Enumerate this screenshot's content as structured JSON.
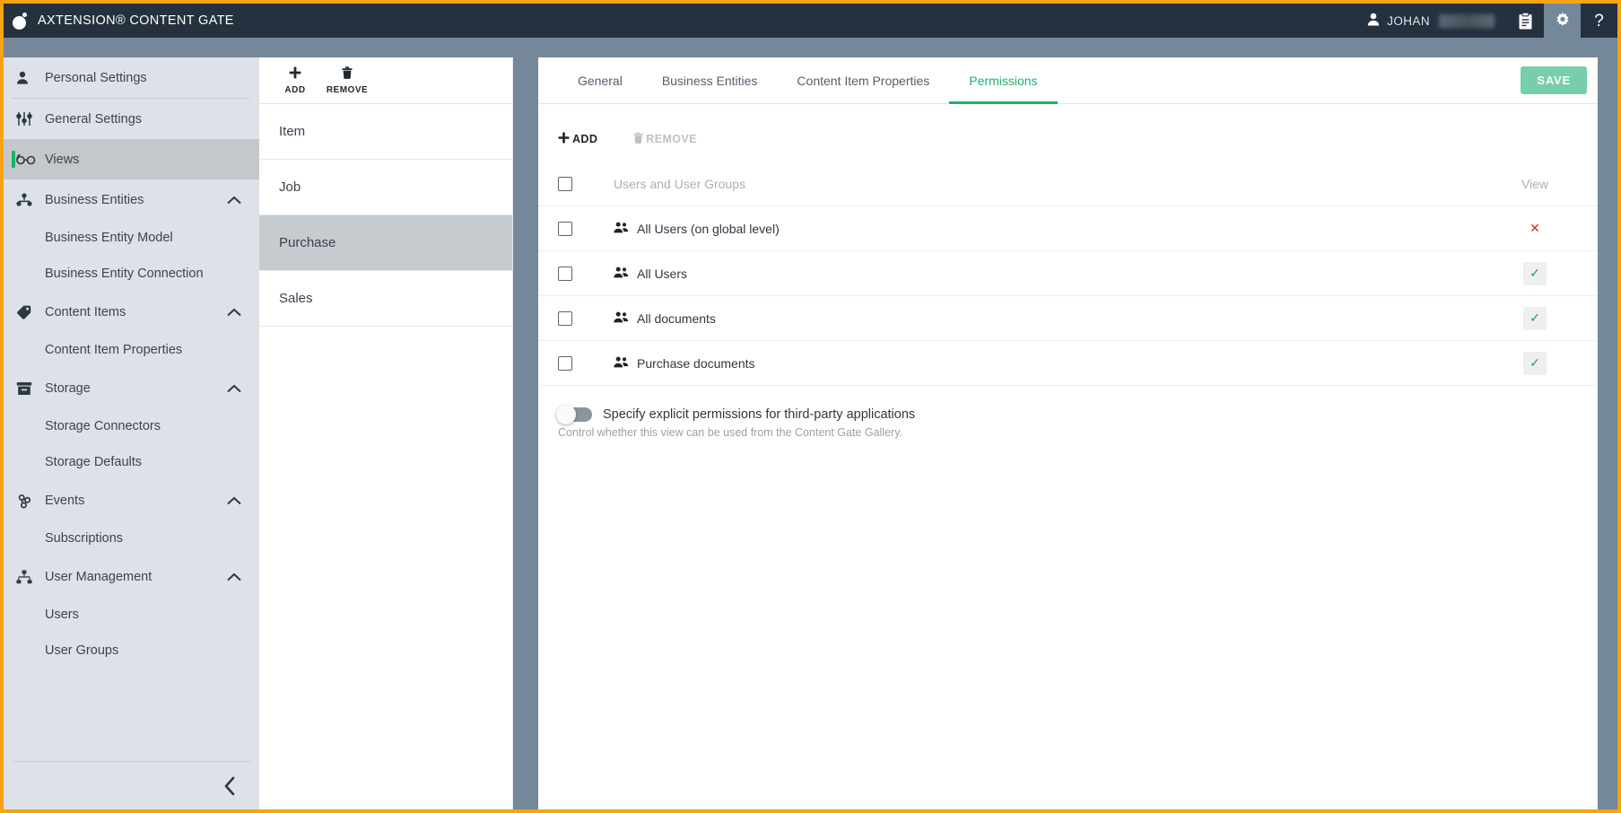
{
  "header": {
    "logo_icon": "axtension-logo-icon",
    "title": "AXTENSION® CONTENT GATE",
    "user_icon": "user-icon",
    "user_name": "JOHAN",
    "clipboard_icon": "clipboard-icon",
    "gear_icon": "gear-icon",
    "help_icon": "help-question-icon",
    "help_glyph": "?",
    "brand_color": "#f5a312",
    "bar_color": "#25313f"
  },
  "sidebar": {
    "collapse_icon": "chevron-left-icon",
    "items": [
      {
        "label": "Personal Settings",
        "icon": "person-icon",
        "type": "item",
        "selected": false,
        "expandable": false
      },
      {
        "label": "General Settings",
        "icon": "sliders-icon",
        "type": "item",
        "selected": false,
        "expandable": false
      },
      {
        "label": "Views",
        "icon": "glasses-icon",
        "type": "item",
        "selected": true,
        "expandable": false
      },
      {
        "label": "Business Entities",
        "icon": "hierarchy-icon",
        "type": "group",
        "selected": false,
        "expandable": true
      },
      {
        "label": "Business Entity Model",
        "type": "sub"
      },
      {
        "label": "Business Entity Connection",
        "type": "sub"
      },
      {
        "label": "Content Items",
        "icon": "tag-icon",
        "type": "group",
        "selected": false,
        "expandable": true
      },
      {
        "label": "Content Item Properties",
        "type": "sub"
      },
      {
        "label": "Storage",
        "icon": "archive-box-icon",
        "type": "group",
        "selected": false,
        "expandable": true
      },
      {
        "label": "Storage Connectors",
        "type": "sub"
      },
      {
        "label": "Storage Defaults",
        "type": "sub"
      },
      {
        "label": "Events",
        "icon": "webhook-icon",
        "type": "group",
        "selected": false,
        "expandable": true
      },
      {
        "label": "Subscriptions",
        "type": "sub"
      },
      {
        "label": "User Management",
        "icon": "sitemap-icon",
        "type": "group",
        "selected": false,
        "expandable": true
      },
      {
        "label": "Users",
        "type": "sub"
      },
      {
        "label": "User Groups",
        "type": "sub"
      }
    ]
  },
  "list_panel": {
    "toolbar": {
      "add_label": "ADD",
      "add_icon": "plus-icon",
      "remove_label": "REMOVE",
      "remove_icon": "trash-icon"
    },
    "rows": [
      {
        "label": "Item",
        "selected": false
      },
      {
        "label": "Job",
        "selected": false
      },
      {
        "label": "Purchase",
        "selected": true
      },
      {
        "label": "Sales",
        "selected": false
      }
    ]
  },
  "main": {
    "tabs": [
      {
        "label": "General",
        "active": false
      },
      {
        "label": "Business Entities",
        "active": false
      },
      {
        "label": "Content Item Properties",
        "active": false
      },
      {
        "label": "Permissions",
        "active": true
      }
    ],
    "save_label": "SAVE",
    "accent_color": "#19b26b",
    "permissions": {
      "toolbar": {
        "add_label": "ADD",
        "add_icon": "plus-icon",
        "remove_label": "REMOVE",
        "remove_icon": "trash-icon",
        "remove_disabled": true
      },
      "columns": {
        "name": "Users and User Groups",
        "view": "View"
      },
      "rows": [
        {
          "name": "All Users (on global level)",
          "icon": "users-group-icon",
          "checked": false,
          "view": "deny",
          "view_glyph": "✕"
        },
        {
          "name": "All Users",
          "icon": "users-group-icon",
          "checked": false,
          "view": "allow",
          "view_glyph": "✓"
        },
        {
          "name": "All documents",
          "icon": "users-group-icon",
          "checked": false,
          "view": "allow",
          "view_glyph": "✓"
        },
        {
          "name": "Purchase documents",
          "icon": "users-group-icon",
          "checked": false,
          "view": "allow",
          "view_glyph": "✓"
        }
      ],
      "toggle": {
        "label": "Specify explicit permissions for third-party applications",
        "help": "Control whether this view can be used from the Content Gate Gallery.",
        "on": false
      }
    }
  }
}
